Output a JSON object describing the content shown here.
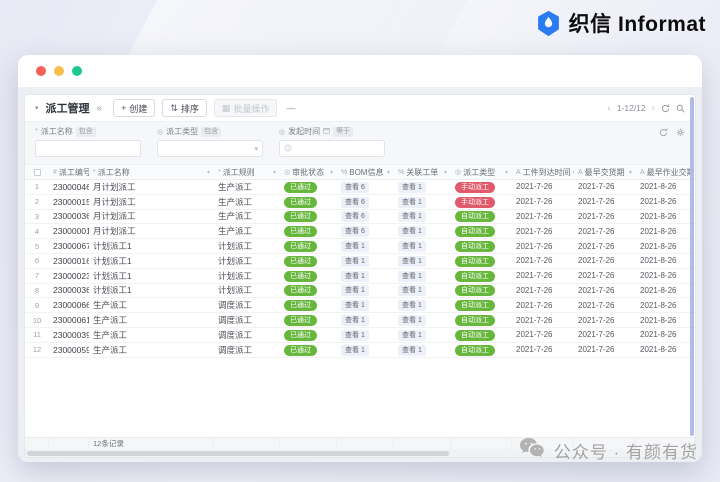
{
  "brand": {
    "name_cn": "织信",
    "name_en": "Informat"
  },
  "icons": {
    "collapse": "▾",
    "share": "«",
    "plus": "+",
    "sort": "⇅",
    "batch": "▦",
    "minus": "—",
    "prev": "‹",
    "next": "›",
    "caret": "▾",
    "chevron_down": "▾"
  },
  "toolbar": {
    "title": "派工管理",
    "create_label": "创建",
    "sort_label": "排序",
    "batch_label": "批量操作",
    "pagination_range": "1-12/12"
  },
  "filters": [
    {
      "label": "派工名称",
      "operator": "包含"
    },
    {
      "label": "派工类型",
      "operator": "包含"
    },
    {
      "label": "发起时间",
      "operator": "等于"
    }
  ],
  "table": {
    "columns": [
      {
        "key": "index",
        "label": "",
        "icon": ""
      },
      {
        "key": "no",
        "label": "派工编号",
        "icon": "#"
      },
      {
        "key": "name",
        "label": "派工名称",
        "icon": "*"
      },
      {
        "key": "rule",
        "label": "派工规则",
        "icon": "*"
      },
      {
        "key": "approve",
        "label": "审批状态",
        "icon": "◎"
      },
      {
        "key": "bom",
        "label": "BOM信息",
        "icon": "%"
      },
      {
        "key": "order",
        "label": "关联工单",
        "icon": "%"
      },
      {
        "key": "type",
        "label": "派工类型",
        "icon": "◎"
      },
      {
        "key": "arrive",
        "label": "工件到达时间",
        "icon": "A"
      },
      {
        "key": "deliver",
        "label": "最早交货期",
        "icon": "A"
      },
      {
        "key": "job_deliver",
        "label": "最早作业交期",
        "icon": "A"
      }
    ],
    "rows": [
      {
        "index": "1",
        "no": "23000046",
        "name": "月计划派工",
        "rule": "生产派工",
        "approve": "已通过",
        "bom": "查看 6",
        "order": "查看 1",
        "type": "手动派工",
        "type_kind": "manual",
        "arrive": "2021-7-26",
        "deliver": "2021-7-26",
        "job_deliver": "2021-8-26"
      },
      {
        "index": "2",
        "no": "23000015",
        "name": "月计划派工",
        "rule": "生产派工",
        "approve": "已通过",
        "bom": "查看 6",
        "order": "查看 1",
        "type": "手动派工",
        "type_kind": "manual",
        "arrive": "2021-7-26",
        "deliver": "2021-7-26",
        "job_deliver": "2021-8-26"
      },
      {
        "index": "3",
        "no": "23000036",
        "name": "月计划派工",
        "rule": "生产派工",
        "approve": "已通过",
        "bom": "查看 6",
        "order": "查看 1",
        "type": "自动派工",
        "type_kind": "auto",
        "arrive": "2021-7-26",
        "deliver": "2021-7-26",
        "job_deliver": "2021-8-26"
      },
      {
        "index": "4",
        "no": "23000001",
        "name": "月计划派工",
        "rule": "生产派工",
        "approve": "已通过",
        "bom": "查看 6",
        "order": "查看 1",
        "type": "自动派工",
        "type_kind": "auto",
        "arrive": "2021-7-26",
        "deliver": "2021-7-26",
        "job_deliver": "2021-8-26"
      },
      {
        "index": "5",
        "no": "23000067",
        "name": "计划派工1",
        "rule": "计划派工",
        "approve": "已通过",
        "bom": "查看 1",
        "order": "查看 1",
        "type": "自动派工",
        "type_kind": "auto",
        "arrive": "2021-7-26",
        "deliver": "2021-7-26",
        "job_deliver": "2021-8-26"
      },
      {
        "index": "6",
        "no": "23000016",
        "name": "计划派工1",
        "rule": "计划派工",
        "approve": "已通过",
        "bom": "查看 1",
        "order": "查看 1",
        "type": "自动派工",
        "type_kind": "auto",
        "arrive": "2021-7-26",
        "deliver": "2021-7-26",
        "job_deliver": "2021-8-26"
      },
      {
        "index": "7",
        "no": "23000023",
        "name": "计划派工1",
        "rule": "计划派工",
        "approve": "已通过",
        "bom": "查看 1",
        "order": "查看 1",
        "type": "自动派工",
        "type_kind": "auto",
        "arrive": "2021-7-26",
        "deliver": "2021-7-26",
        "job_deliver": "2021-8-26"
      },
      {
        "index": "8",
        "no": "23000036",
        "name": "计划派工1",
        "rule": "计划派工",
        "approve": "已通过",
        "bom": "查看 1",
        "order": "查看 1",
        "type": "自动派工",
        "type_kind": "auto",
        "arrive": "2021-7-26",
        "deliver": "2021-7-26",
        "job_deliver": "2021-8-26"
      },
      {
        "index": "9",
        "no": "23000066",
        "name": "生产派工",
        "rule": "调度派工",
        "approve": "已通过",
        "bom": "查看 1",
        "order": "查看 1",
        "type": "自动派工",
        "type_kind": "auto",
        "arrive": "2021-7-26",
        "deliver": "2021-7-26",
        "job_deliver": "2021-8-26"
      },
      {
        "index": "10",
        "no": "23000061",
        "name": "生产派工",
        "rule": "调度派工",
        "approve": "已通过",
        "bom": "查看 1",
        "order": "查看 1",
        "type": "自动派工",
        "type_kind": "auto",
        "arrive": "2021-7-26",
        "deliver": "2021-7-26",
        "job_deliver": "2021-8-26"
      },
      {
        "index": "11",
        "no": "23000039",
        "name": "生产派工",
        "rule": "调度派工",
        "approve": "已通过",
        "bom": "查看 1",
        "order": "查看 1",
        "type": "自动派工",
        "type_kind": "auto",
        "arrive": "2021-7-26",
        "deliver": "2021-7-26",
        "job_deliver": "2021-8-26"
      },
      {
        "index": "12",
        "no": "23000059",
        "name": "生产派工",
        "rule": "调度派工",
        "approve": "已通过",
        "bom": "查看 1",
        "order": "查看 1",
        "type": "自动派工",
        "type_kind": "auto",
        "arrive": "2021-7-26",
        "deliver": "2021-7-26",
        "job_deliver": "2021-8-26"
      }
    ],
    "summary_total": "12条记录"
  },
  "watermark": {
    "text": "公众号 · 有颜有货"
  },
  "colors": {
    "accent_blue": "#2b7bf3",
    "badge_green": "#67b73d",
    "badge_red": "#e05a6b",
    "scrollbar_purple": "#b2bbe8",
    "dot_red": "#f75f58",
    "dot_yellow": "#f9bd4d",
    "dot_green": "#1ec88f"
  }
}
